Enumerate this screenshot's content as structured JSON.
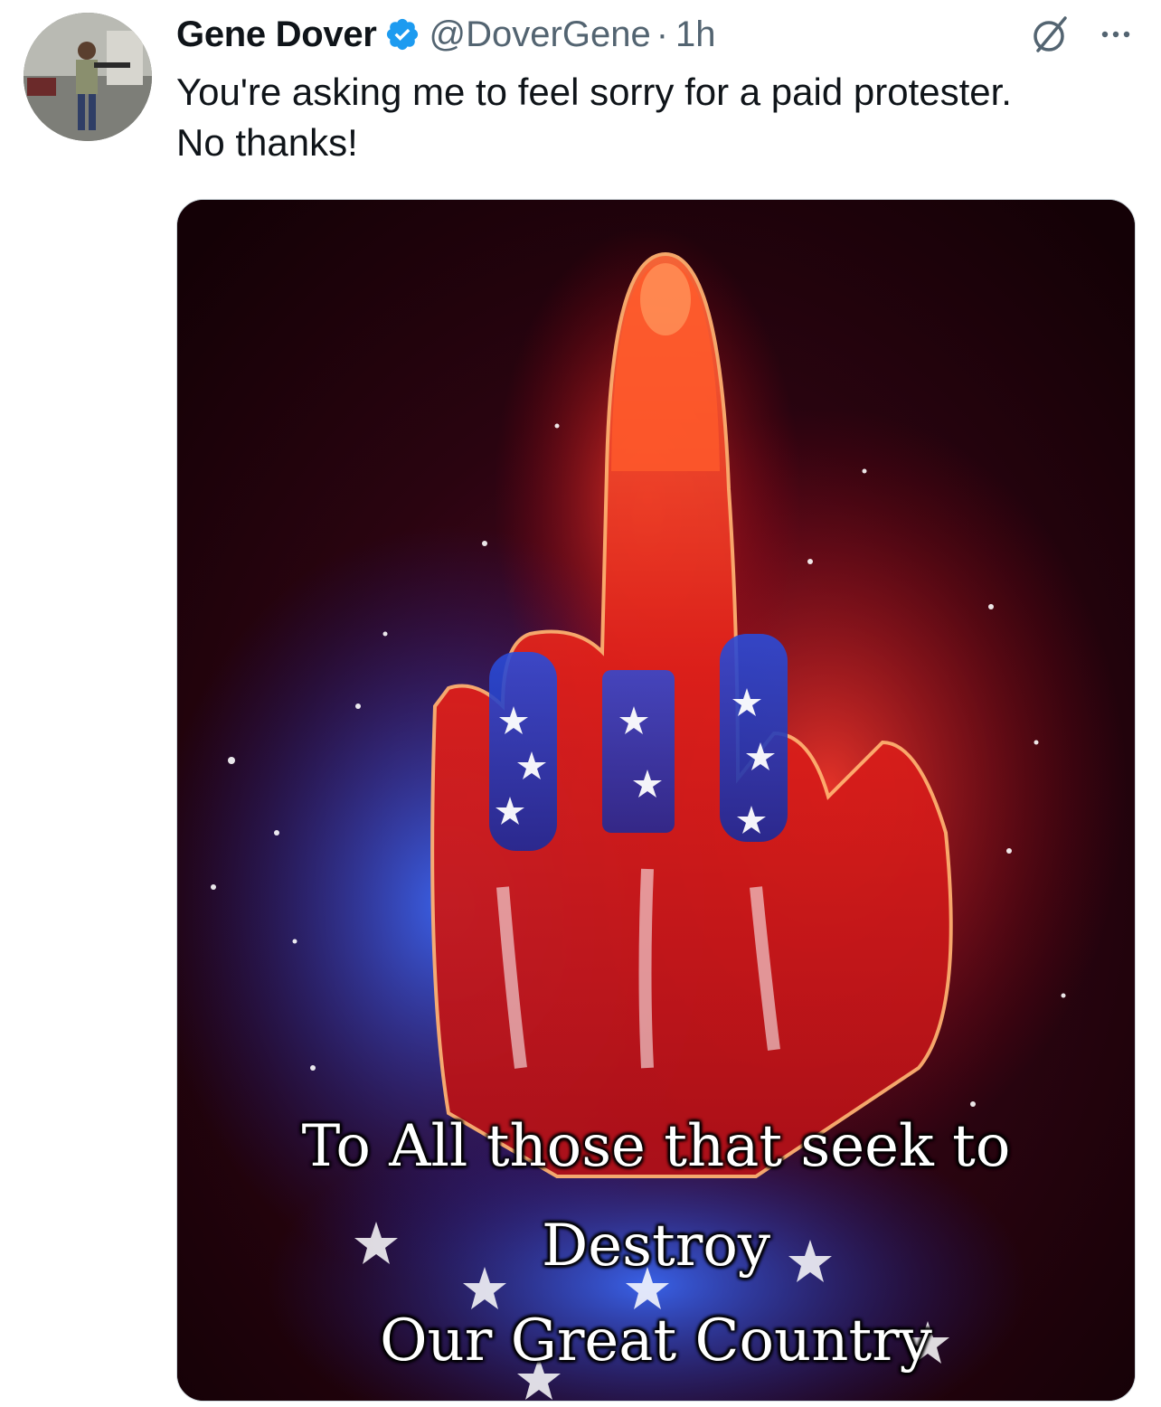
{
  "author": {
    "display_name": "Gene Dover",
    "handle": "@DoverGene",
    "separator": "·",
    "time": "1h",
    "verified": true,
    "verified_color": "#1d9bf0"
  },
  "tweet": {
    "text": "You're asking me to feel sorry for a paid protester.\nNo thanks!"
  },
  "media": {
    "caption_lines": [
      "To All those that seek to",
      "Destroy",
      "Our Great Country"
    ]
  },
  "icons": {
    "avatar": "avatar",
    "verified": "verified-badge-icon",
    "grok": "grok-icon",
    "more": "more-icon"
  },
  "colors": {
    "text_primary": "#0f1419",
    "text_secondary": "#536471",
    "border": "#cfd9de"
  }
}
